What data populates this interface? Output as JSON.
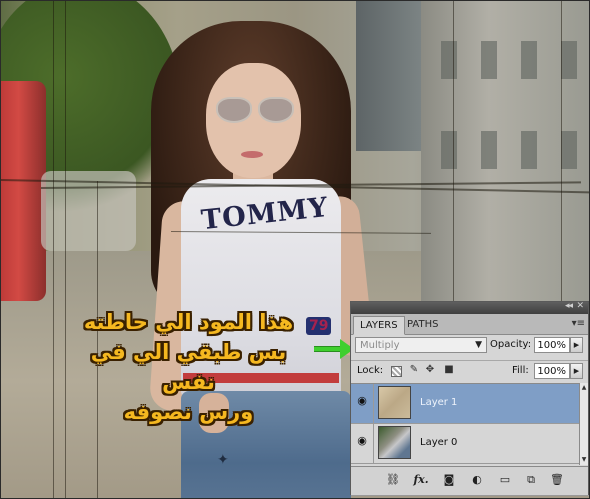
{
  "overlay_caption": {
    "lines": [
      "هذا المود الي حاطته",
      "بس طبقي الي في نفس",
      "ورس نصوفه"
    ]
  },
  "photo": {
    "shirt_brand": "TOMMY",
    "shirt_number": "79"
  },
  "layers_panel": {
    "tabs": [
      {
        "label": "LAYERS",
        "active": true
      },
      {
        "label": "PATHS",
        "active": false
      }
    ],
    "blend_mode": "Multiply",
    "opacity_label": "Opacity:",
    "opacity_value": "100%",
    "lock_label": "Lock:",
    "fill_label": "Fill:",
    "fill_value": "100%",
    "layers": [
      {
        "name": "Layer 1",
        "visible": true,
        "selected": true,
        "thumb": "beige-texture"
      },
      {
        "name": "Layer 0",
        "visible": true,
        "selected": false,
        "thumb": "photo"
      }
    ],
    "icons": {
      "collapse": "double-arrow-icon",
      "close": "close-icon",
      "menu": "panel-menu-icon",
      "eye": "eye-icon",
      "footer": [
        "link-icon",
        "fx-icon",
        "mask-icon",
        "adjustment-icon",
        "folder-icon",
        "new-layer-icon",
        "trash-icon"
      ]
    },
    "colors": {
      "selected_row": "#7f9ec6",
      "panel_bg": "#d6d6d6"
    }
  },
  "annotation_arrow_color": "#3fcf2e"
}
